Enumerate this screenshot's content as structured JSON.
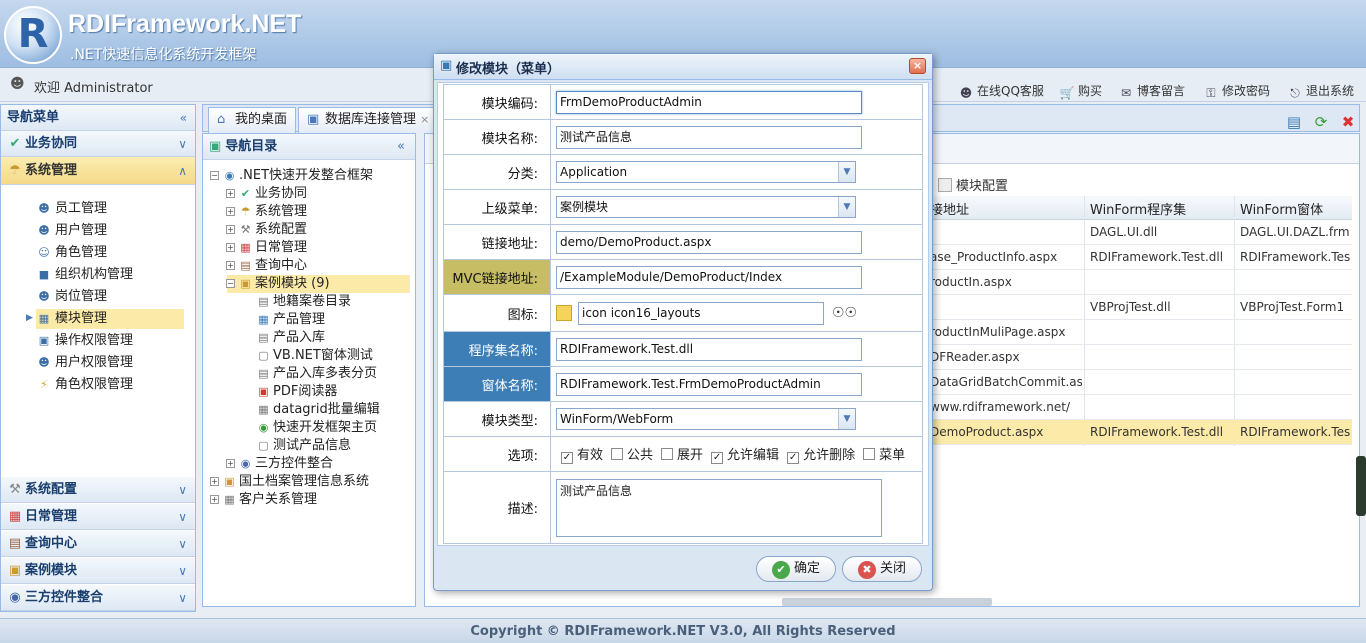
{
  "app": {
    "logo_letter": "R",
    "title": "RDIFramework.NET",
    "subtitle": ".NET快速信息化系统开发框架"
  },
  "userbar": {
    "welcome": "欢迎 Administrator",
    "links": [
      "在线QQ客服",
      "购买",
      "博客留言",
      "修改密码",
      "退出系统"
    ]
  },
  "leftnav": {
    "title": "导航菜单",
    "sections_top": [
      "业务协同",
      "系统管理"
    ],
    "items": [
      "员工管理",
      "用户管理",
      "角色管理",
      "组织机构管理",
      "岗位管理",
      "模块管理",
      "操作权限管理",
      "用户权限管理",
      "角色权限管理"
    ],
    "sections_bottom": [
      "系统配置",
      "日常管理",
      "查询中心",
      "案例模块",
      "三方控件整合"
    ]
  },
  "tabs": [
    "我的桌面",
    "数据库连接管理"
  ],
  "tree": {
    "title": "导航目录",
    "root": ".NET快速开发整合框架",
    "level1": [
      "业务协同",
      "系统管理",
      "系统配置",
      "日常管理",
      "查询中心",
      "案例模块 (9)"
    ],
    "case_children": [
      "地籍案卷目录",
      "产品管理",
      "产品入库",
      "VB.NET窗体测试",
      "产品入库多表分页",
      "PDF阅读器",
      "datagrid批量编辑",
      "快速开发框架主页",
      "测试产品信息"
    ],
    "level1_after": [
      "三方控件整合"
    ],
    "roots_after": [
      "国土档案管理信息系统",
      "客户关系管理"
    ]
  },
  "grid": {
    "toolbar_label": "模块配置",
    "headers": [
      "接地址",
      "WinForm程序集",
      "WinForm窗体"
    ],
    "rows": [
      [
        "",
        "DAGL.UI.dll",
        "DAGL.UI.DAZL.frm"
      ],
      [
        "ase_ProductInfo.aspx",
        "RDIFramework.Test.dll",
        "RDIFramework.Tes"
      ],
      [
        "roductIn.aspx",
        "",
        ""
      ],
      [
        "",
        "VBProjTest.dll",
        "VBProjTest.Form1"
      ],
      [
        "roductInMuliPage.aspx",
        "",
        ""
      ],
      [
        "DFReader.aspx",
        "",
        ""
      ],
      [
        "DataGridBatchCommit.asp",
        "",
        ""
      ],
      [
        "www.rdiframework.net/",
        "",
        ""
      ],
      [
        "DemoProduct.aspx",
        "RDIFramework.Test.dll",
        "RDIFramework.Tes"
      ]
    ]
  },
  "dialog": {
    "title": "修改模块（菜单）",
    "close": "×",
    "labels": {
      "code": "模块编码:",
      "name": "模块名称:",
      "category": "分类:",
      "parent": "上级菜单:",
      "url": "链接地址:",
      "mvc_url": "MVC链接地址:",
      "icon": "图标:",
      "assembly": "程序集名称:",
      "form": "窗体名称:",
      "type": "模块类型:",
      "options": "选项:",
      "desc": "描述:"
    },
    "values": {
      "code": "FrmDemoProductAdmin",
      "name": "测试产品信息",
      "category": "Application",
      "parent": "案例模块",
      "url": "demo/DemoProduct.aspx",
      "mvc_url": "/ExampleModule/DemoProduct/Index",
      "icon": "icon icon16_layouts",
      "assembly": "RDIFramework.Test.dll",
      "form": "RDIFramework.Test.FrmDemoProductAdmin",
      "type": "WinForm/WebForm",
      "desc": "测试产品信息"
    },
    "options": [
      {
        "label": "有效",
        "checked": true
      },
      {
        "label": "公共",
        "checked": false
      },
      {
        "label": "展开",
        "checked": false
      },
      {
        "label": "允许编辑",
        "checked": true
      },
      {
        "label": "允许删除",
        "checked": true
      },
      {
        "label": "菜单",
        "checked": false
      }
    ],
    "ok_label": "确定",
    "cancel_label": "关闭"
  },
  "footer": "Copyright © RDIFramework.NET V3.0, All Rights Reserved",
  "colors": {
    "accent": "#99bbe8",
    "selected": "#fbeaa8",
    "mvc_label": "#c7bd64",
    "highlight_label": "#3d7eb6"
  }
}
